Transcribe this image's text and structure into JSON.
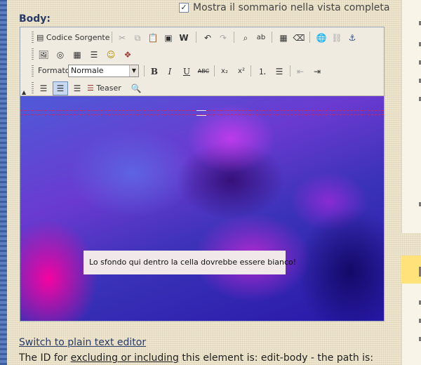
{
  "summary": {
    "checked_glyph": "✓",
    "label": "Mostra il sommario nella vista completa"
  },
  "body_label": "Body:",
  "toolbar": {
    "source_label": "Codice Sorgente",
    "format_label": "Formato",
    "format_value": "Normale",
    "teaser_label": "Teaser",
    "icons": {
      "source": "▤",
      "cut": "✂",
      "copy": "⧉",
      "paste": "📋",
      "paste_text": "▣",
      "paste_word": "W",
      "undo": "↶",
      "redo": "↷",
      "find": "⌕",
      "replace": "ab",
      "select_all": "▦",
      "remove_format": "⌫",
      "link": "🌐",
      "unlink": "⛓",
      "anchor": "⚓",
      "image": "🖼",
      "flash": "◎",
      "table": "▦",
      "hrule": "☰",
      "smiley": "☺",
      "special_char": "❖",
      "bold": "B",
      "italic": "I",
      "underline": "U",
      "strike": "ABC",
      "subscript": "x₂",
      "superscript": "x²",
      "ordered_list": "⒈",
      "bullet_list": "☰",
      "outdent": "⇤",
      "indent": "⇥",
      "align_left": "☰",
      "align_center": "☰",
      "align_right": "☰",
      "teaser": "☰",
      "preview": "🔍",
      "dropdown": "▼",
      "collapse": "▲"
    }
  },
  "content": {
    "note": "Lo sfondo qui dentro la cella dovrebbe essere bianco!"
  },
  "footer": {
    "switch_link": "Switch to plain text editor",
    "id_prefix": "The ID for ",
    "id_link_excluding": "excluding or including",
    "id_suffix": " this element is: edit-body - the path is:"
  },
  "colors": {
    "accent": "#2a3a66",
    "dashline": "#c8285a",
    "note_bg": "#f1e8ea"
  }
}
